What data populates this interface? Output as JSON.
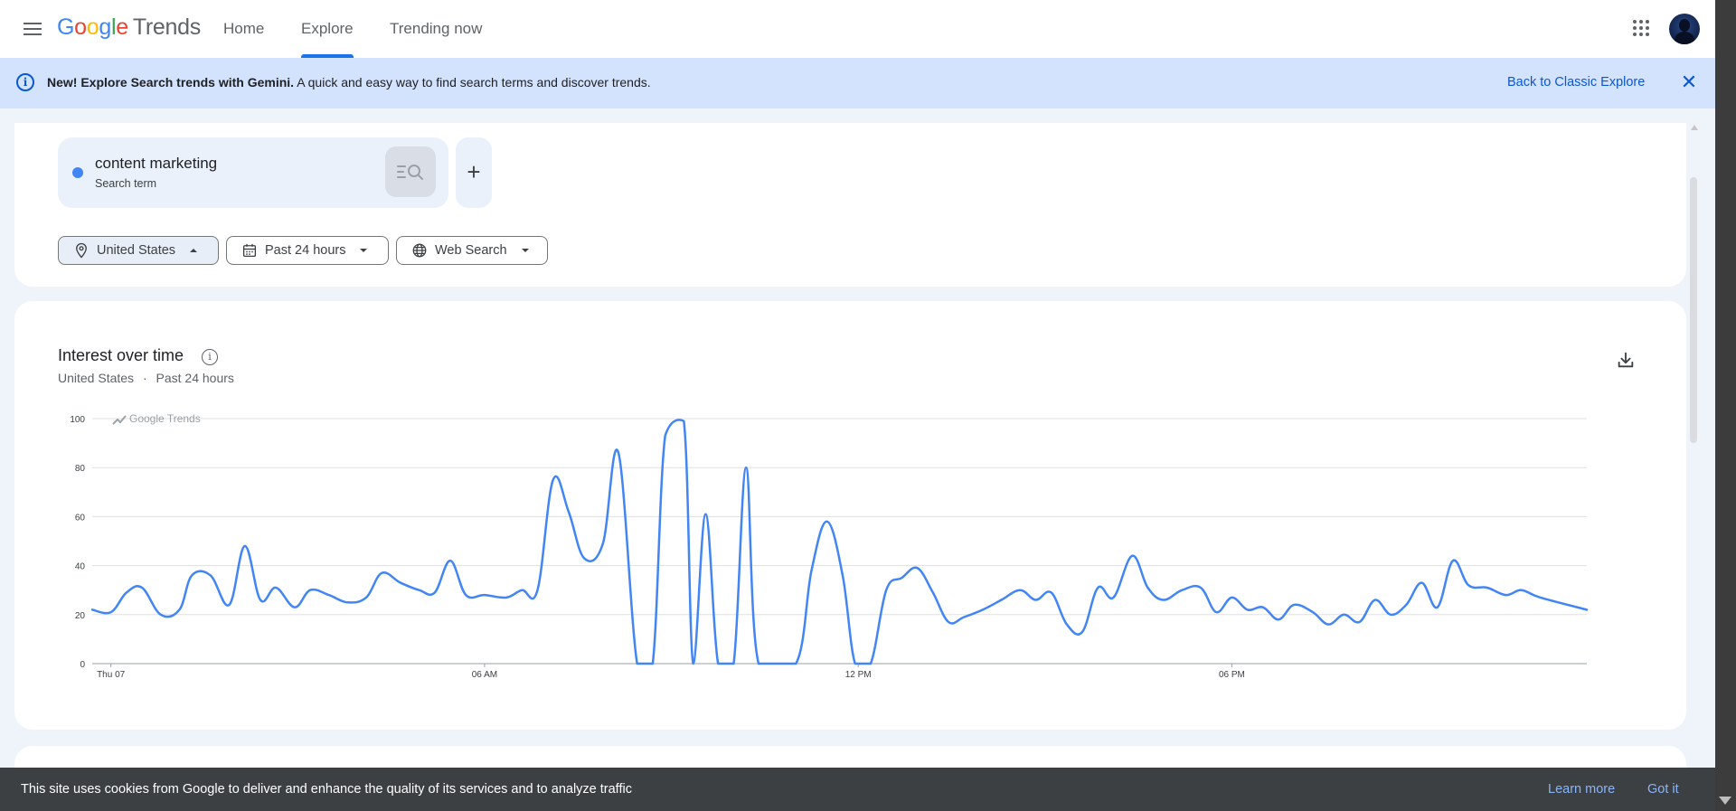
{
  "header": {
    "logo_letters": [
      "G",
      "o",
      "o",
      "g",
      "l",
      "e"
    ],
    "logo_product": "Trends",
    "nav": [
      {
        "label": "Home"
      },
      {
        "label": "Explore"
      },
      {
        "label": "Trending now"
      }
    ],
    "active_tab": "Explore"
  },
  "banner": {
    "bold_text": "New! Explore Search trends with Gemini.",
    "text": " A quick and easy way to find search terms and discover trends.",
    "link": "Back to Classic Explore",
    "close_icon": "close-icon"
  },
  "search": {
    "term": "content marketing",
    "term_type": "Search term",
    "term_color": "#4285f4",
    "add_label": "+"
  },
  "filters": {
    "region": "United States",
    "time": "Past 24 hours",
    "property": "Web Search"
  },
  "chart_card": {
    "title": "Interest over time",
    "subtitle_region": "United States",
    "subtitle_separator": "·",
    "subtitle_time": "Past 24 hours",
    "watermark": "Google Trends"
  },
  "chart_data": {
    "type": "line",
    "title": "Interest over time",
    "xlabel": "",
    "ylabel": "",
    "ylim": [
      0,
      100
    ],
    "yticks": [
      0,
      20,
      40,
      60,
      80,
      100
    ],
    "xtick_labels": [
      "Thu 07",
      "06 AM",
      "12 PM",
      "06 PM"
    ],
    "xtick_hours": [
      0.3,
      6.3,
      12.3,
      18.3
    ],
    "xlim_hours": [
      0,
      24
    ],
    "grid": true,
    "series": [
      {
        "name": "content marketing",
        "color": "#4285f4",
        "points": [
          [
            0.0,
            22
          ],
          [
            0.3,
            21
          ],
          [
            0.55,
            29
          ],
          [
            0.8,
            31
          ],
          [
            1.1,
            20
          ],
          [
            1.4,
            22
          ],
          [
            1.6,
            36
          ],
          [
            1.9,
            36
          ],
          [
            2.2,
            24
          ],
          [
            2.45,
            48
          ],
          [
            2.7,
            26
          ],
          [
            2.95,
            31
          ],
          [
            3.25,
            23
          ],
          [
            3.5,
            30
          ],
          [
            3.8,
            28
          ],
          [
            4.1,
            25
          ],
          [
            4.4,
            27
          ],
          [
            4.65,
            37
          ],
          [
            4.95,
            33
          ],
          [
            5.25,
            30
          ],
          [
            5.5,
            29
          ],
          [
            5.75,
            42
          ],
          [
            6.0,
            28
          ],
          [
            6.3,
            28
          ],
          [
            6.65,
            27
          ],
          [
            6.9,
            30
          ],
          [
            7.15,
            30
          ],
          [
            7.4,
            75
          ],
          [
            7.65,
            62
          ],
          [
            7.9,
            43
          ],
          [
            8.2,
            49
          ],
          [
            8.45,
            86
          ],
          [
            8.75,
            0
          ],
          [
            9.0,
            0
          ],
          [
            9.2,
            93
          ],
          [
            9.5,
            99
          ],
          [
            9.65,
            0
          ],
          [
            9.85,
            61
          ],
          [
            10.05,
            0
          ],
          [
            10.3,
            0
          ],
          [
            10.5,
            80
          ],
          [
            10.7,
            0
          ],
          [
            11.3,
            0
          ],
          [
            11.55,
            38
          ],
          [
            11.8,
            58
          ],
          [
            12.05,
            36
          ],
          [
            12.25,
            0
          ],
          [
            12.5,
            0
          ],
          [
            12.75,
            30
          ],
          [
            13.0,
            35
          ],
          [
            13.25,
            39
          ],
          [
            13.5,
            29
          ],
          [
            13.75,
            17
          ],
          [
            14.0,
            19
          ],
          [
            14.3,
            22
          ],
          [
            14.6,
            26
          ],
          [
            14.9,
            30
          ],
          [
            15.15,
            26
          ],
          [
            15.4,
            29
          ],
          [
            15.65,
            16
          ],
          [
            15.9,
            13
          ],
          [
            16.15,
            31
          ],
          [
            16.4,
            27
          ],
          [
            16.7,
            44
          ],
          [
            16.95,
            31
          ],
          [
            17.2,
            26
          ],
          [
            17.5,
            30
          ],
          [
            17.8,
            31
          ],
          [
            18.05,
            21
          ],
          [
            18.3,
            27
          ],
          [
            18.55,
            22
          ],
          [
            18.8,
            23
          ],
          [
            19.05,
            18
          ],
          [
            19.3,
            24
          ],
          [
            19.6,
            21
          ],
          [
            19.85,
            16
          ],
          [
            20.1,
            20
          ],
          [
            20.35,
            17
          ],
          [
            20.6,
            26
          ],
          [
            20.85,
            20
          ],
          [
            21.1,
            24
          ],
          [
            21.35,
            33
          ],
          [
            21.6,
            23
          ],
          [
            21.85,
            42
          ],
          [
            22.1,
            32
          ],
          [
            22.4,
            31
          ],
          [
            22.7,
            28
          ],
          [
            22.95,
            30
          ],
          [
            23.25,
            27
          ],
          [
            24.0,
            22
          ]
        ]
      }
    ]
  },
  "icons": {
    "menu": "menu-icon",
    "apps": "apps-grid-icon",
    "location": "location-pin-icon",
    "calendar": "calendar-icon",
    "globe": "globe-icon",
    "download": "download-icon",
    "info": "info-icon"
  },
  "cookie": {
    "text": "This site uses cookies from Google to deliver and enhance the quality of its services and to analyze traffic",
    "learn_more": "Learn more",
    "got_it": "Got it"
  }
}
